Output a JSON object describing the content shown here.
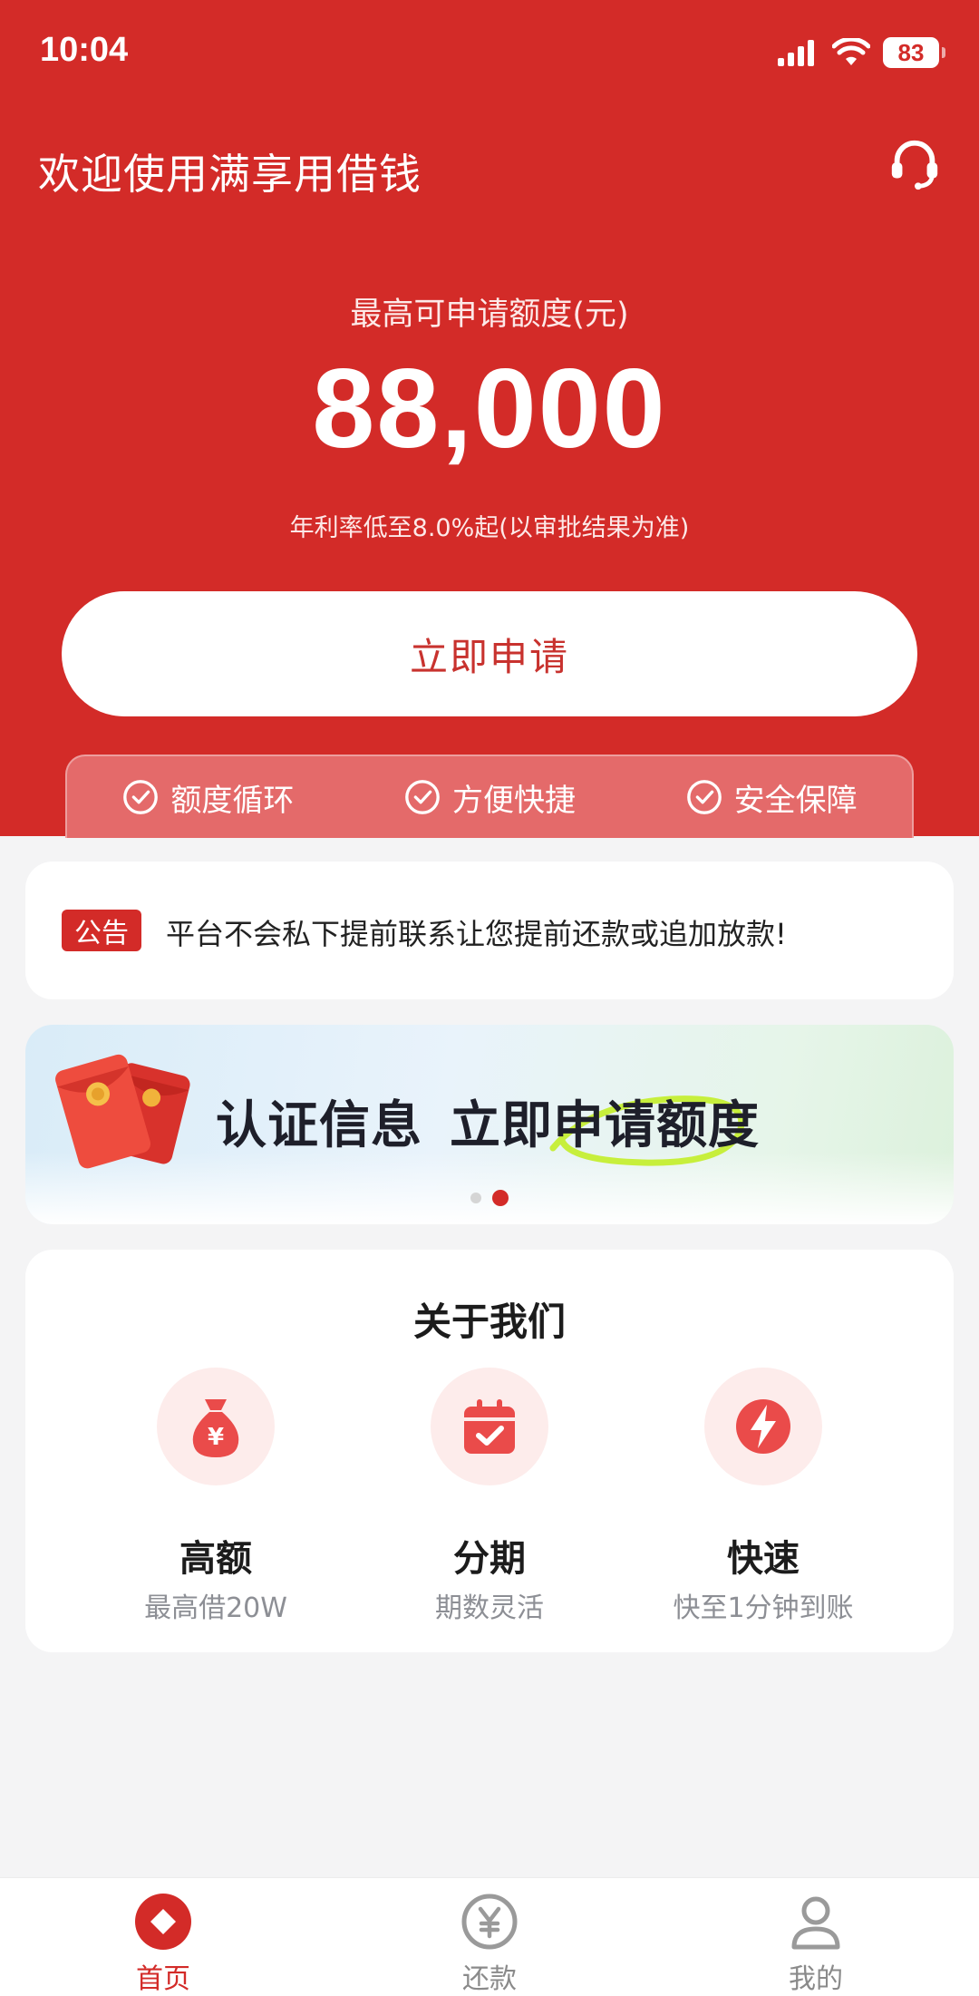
{
  "status_bar": {
    "time": "10:04",
    "battery": "83"
  },
  "header": {
    "title": "欢迎使用满享用借钱"
  },
  "hero": {
    "limit_label": "最高可申请额度(元)",
    "limit_value": "88,000",
    "rate_note": "年利率低至8.0%起(以审批结果为准)",
    "apply_label": "立即申请"
  },
  "features": [
    {
      "label": "额度循环",
      "icon": "check-circle-icon"
    },
    {
      "label": "方便快捷",
      "icon": "check-circle-icon"
    },
    {
      "label": "安全保障",
      "icon": "check-circle-icon"
    }
  ],
  "notice": {
    "tag": "公告",
    "text": "平台不会私下提前联系让您提前还款或追加放款!"
  },
  "banner": {
    "part1": "认证信息",
    "part2": "立即申请额度",
    "page_count": 2,
    "active_page": 2
  },
  "about": {
    "title": "关于我们",
    "items": [
      {
        "name": "高额",
        "sub": "最高借20W",
        "icon": "money-bag-icon"
      },
      {
        "name": "分期",
        "sub": "期数灵活",
        "icon": "calendar-check-icon"
      },
      {
        "name": "快速",
        "sub": "快至1分钟到账",
        "icon": "lightning-icon"
      }
    ]
  },
  "tabbar": [
    {
      "label": "首页",
      "icon": "home-diamond-icon",
      "active": true
    },
    {
      "label": "还款",
      "icon": "yuan-coin-icon",
      "active": false
    },
    {
      "label": "我的",
      "icon": "user-icon",
      "active": false
    }
  ],
  "colors": {
    "primary": "#d32b28",
    "background": "#f4f4f5",
    "icon_bg": "#fdeceb",
    "muted_text": "#8d8f95"
  }
}
